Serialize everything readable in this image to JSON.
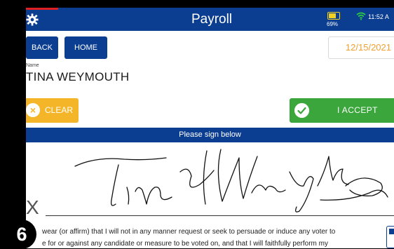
{
  "header": {
    "title": "Payroll",
    "battery_percent": "69%",
    "clock": "11:52 A"
  },
  "nav": {
    "back_label": "BACK",
    "home_label": "HOME",
    "date": "12/15/2021"
  },
  "name_field": {
    "label": "Name",
    "value": "TINA WEYMOUTH"
  },
  "actions": {
    "clear_label": "CLEAR",
    "accept_label": "I ACCEPT"
  },
  "signature": {
    "prompt": "Please sign below",
    "x_mark": "X"
  },
  "oath": {
    "line1": "wear (or affirm) that I will not in any manner request or seek to persuade or induce any voter to",
    "line2": "e for or against any candidate or measure to be voted on, and that I will faithfully perform my"
  },
  "step_badge": "6",
  "colors": {
    "header_bg": "#0b3d91",
    "clear_bg": "#f4b628",
    "accept_bg": "#3aa63c",
    "date_text": "#f0a030",
    "battery": "#f0d020",
    "wifi": "#2ecc40"
  },
  "icons": {
    "settings": "gear-icon",
    "battery": "battery-icon",
    "wifi": "wifi-icon",
    "clear": "close-icon",
    "accept": "check-icon"
  }
}
